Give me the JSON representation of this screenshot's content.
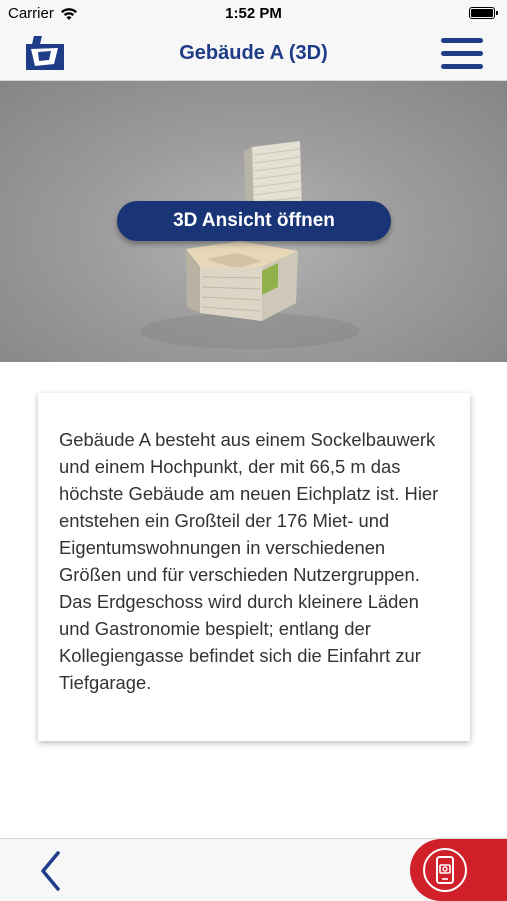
{
  "status_bar": {
    "carrier": "Carrier",
    "time": "1:52 PM",
    "icons": [
      "wifi-icon",
      "battery-icon"
    ]
  },
  "nav": {
    "title": "Gebäude A (3D)",
    "logo": "app-logo",
    "menu_icon": "hamburger-menu-icon",
    "accent_color": "#1f3c88"
  },
  "preview": {
    "button_label": "3D Ansicht öffnen",
    "button_color": "#1a3478",
    "image": "building-3d-model"
  },
  "description": {
    "text": "Gebäude A besteht aus einem Sockelbauwerk und einem Hochpunkt, der mit 66,5 m das höchste Gebäude am neuen Eichplatz ist. Hier entstehen ein Großteil der 176 Miet- und Eigentumswohnungen in verschiedenen Größen und für verschieden Nutzergruppen. Das Erdgeschoss wird durch kleinere Läden und Gastronomie bespielt; entlang der Kollegiengasse befindet sich die Einfahrt zur Tiefgarage."
  },
  "bottom_bar": {
    "back_icon": "chevron-left-icon",
    "ar_icon": "ar-camera-icon",
    "ar_color": "#d0202a"
  }
}
